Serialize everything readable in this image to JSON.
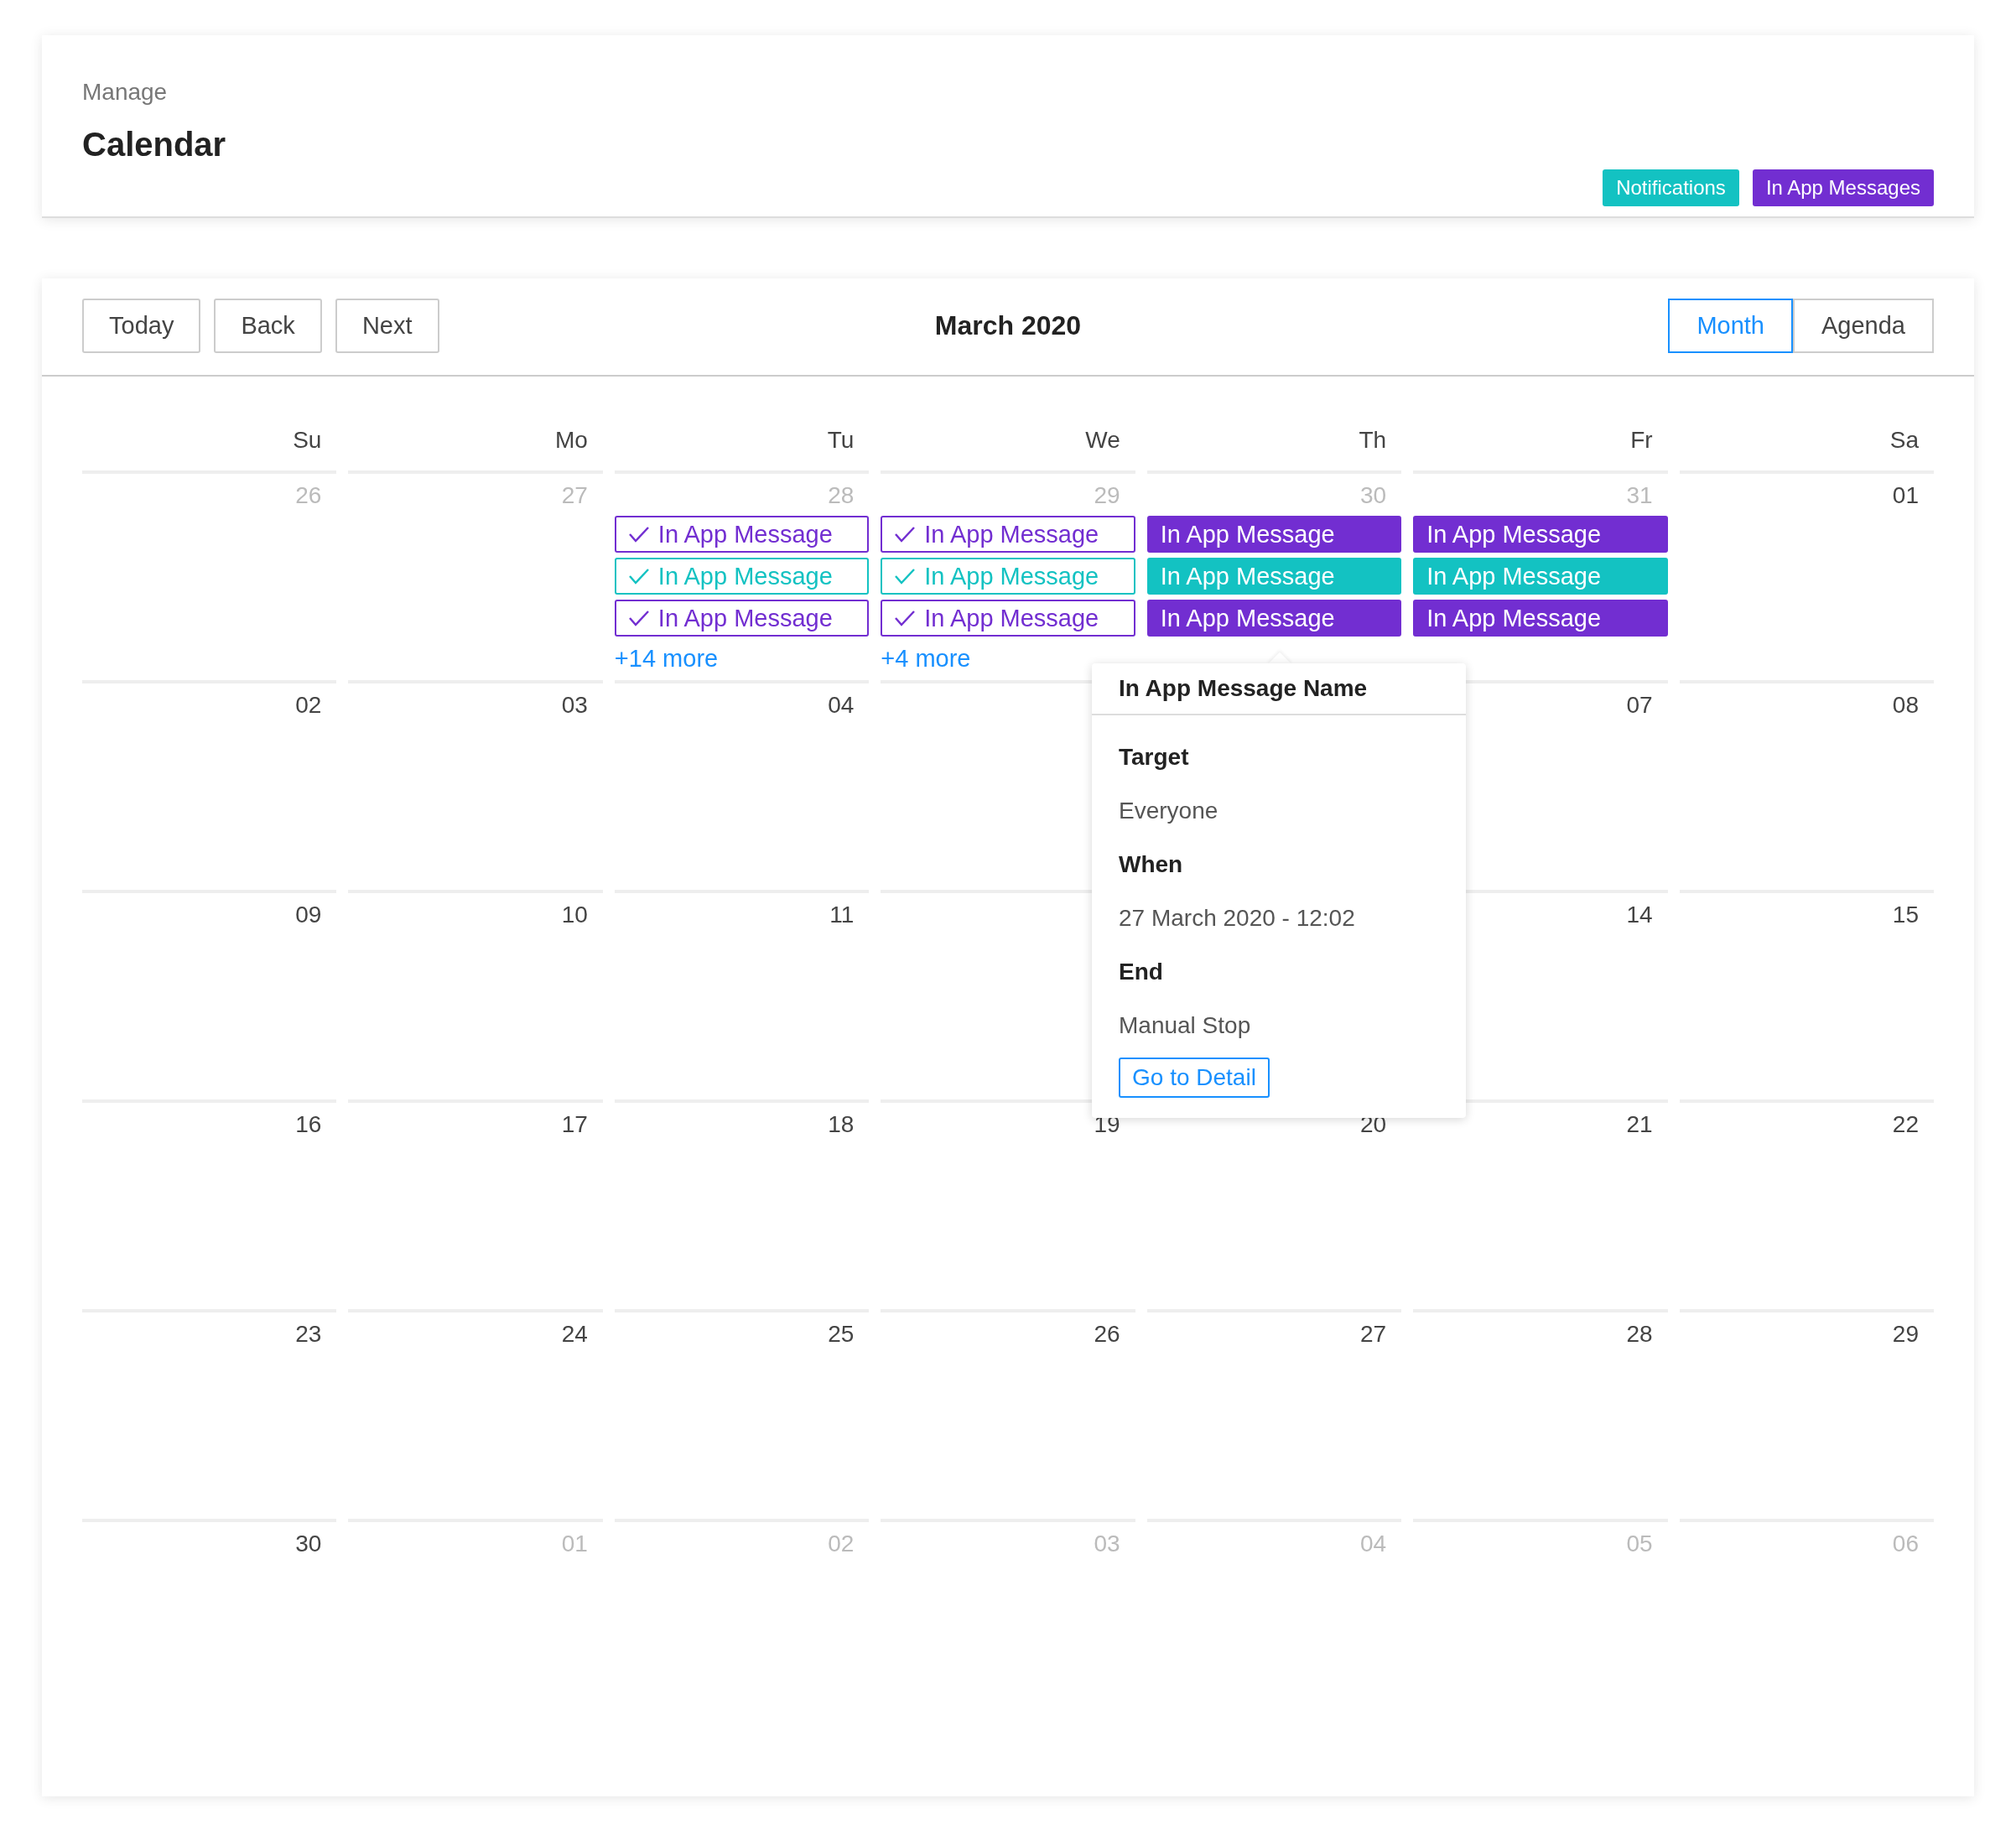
{
  "header": {
    "breadcrumb": "Manage",
    "title": "Calendar",
    "legend": [
      {
        "label": "Notifications",
        "color": "#13c2c2"
      },
      {
        "label": "In App Messages",
        "color": "#722ed1"
      }
    ]
  },
  "toolbar": {
    "nav_buttons": [
      "Today",
      "Back",
      "Next"
    ],
    "title": "March 2020",
    "views": [
      {
        "label": "Month",
        "selected": true
      },
      {
        "label": "Agenda",
        "selected": false
      }
    ]
  },
  "weekdays": [
    "Su",
    "Mo",
    "Tu",
    "We",
    "Th",
    "Fr",
    "Sa"
  ],
  "weeks": [
    {
      "days": [
        {
          "label": "26",
          "muted": true
        },
        {
          "label": "27",
          "muted": true
        },
        {
          "label": "28",
          "muted": true,
          "events": [
            {
              "title": "In App Message",
              "checked": true,
              "color": "#722ed1"
            },
            {
              "title": "In App Message",
              "checked": true,
              "color": "#13c2c2"
            },
            {
              "title": "In App Message",
              "checked": true,
              "color": "#722ed1"
            }
          ],
          "more": "+14 more"
        },
        {
          "label": "29",
          "muted": true,
          "events": [
            {
              "title": "In App Message",
              "checked": true,
              "color": "#722ed1"
            },
            {
              "title": "In App Message",
              "checked": true,
              "color": "#13c2c2"
            },
            {
              "title": "In App Message",
              "checked": true,
              "color": "#722ed1"
            }
          ],
          "more": "+4 more"
        },
        {
          "label": "30",
          "muted": true,
          "events": [
            {
              "title": "In App Message",
              "checked": false,
              "color": "#722ed1"
            },
            {
              "title": "In App Message",
              "checked": false,
              "color": "#13c2c2"
            },
            {
              "title": "In App Message",
              "checked": false,
              "color": "#722ed1"
            }
          ]
        },
        {
          "label": "31",
          "muted": true,
          "events": [
            {
              "title": "In App Message",
              "checked": false,
              "color": "#722ed1"
            },
            {
              "title": "In App Message",
              "checked": false,
              "color": "#13c2c2"
            },
            {
              "title": "In App Message",
              "checked": false,
              "color": "#722ed1"
            }
          ]
        },
        {
          "label": "01",
          "muted": false
        }
      ]
    },
    {
      "days": [
        {
          "label": "02",
          "muted": false
        },
        {
          "label": "03",
          "muted": false
        },
        {
          "label": "04",
          "muted": false
        }
      ],
      "days_after_popover": [
        {
          "label": "07",
          "muted": false
        },
        {
          "label": "08",
          "muted": false
        }
      ]
    },
    {
      "days": [
        {
          "label": "09",
          "muted": false
        },
        {
          "label": "10",
          "muted": false
        },
        {
          "label": "11",
          "muted": false
        }
      ],
      "days_after_popover": [
        {
          "label": "14",
          "muted": false
        },
        {
          "label": "15",
          "muted": false
        }
      ]
    },
    {
      "days": [
        {
          "label": "16",
          "muted": false
        },
        {
          "label": "17",
          "muted": false
        },
        {
          "label": "18",
          "muted": false
        },
        {
          "label": "19",
          "muted": false
        },
        {
          "label": "20",
          "muted": false
        },
        {
          "label": "21",
          "muted": false
        },
        {
          "label": "22",
          "muted": false
        }
      ]
    },
    {
      "days": [
        {
          "label": "23",
          "muted": false
        },
        {
          "label": "24",
          "muted": false
        },
        {
          "label": "25",
          "muted": false
        },
        {
          "label": "26",
          "muted": false
        },
        {
          "label": "27",
          "muted": false
        },
        {
          "label": "28",
          "muted": false
        },
        {
          "label": "29",
          "muted": false
        }
      ]
    },
    {
      "days": [
        {
          "label": "30",
          "muted": false
        },
        {
          "label": "01",
          "muted": true
        },
        {
          "label": "02",
          "muted": true
        },
        {
          "label": "03",
          "muted": true
        },
        {
          "label": "04",
          "muted": true
        },
        {
          "label": "05",
          "muted": true
        },
        {
          "label": "06",
          "muted": true
        }
      ]
    }
  ],
  "popover": {
    "title": "In App Message Name",
    "fields": [
      {
        "label": "Target",
        "value": "Everyone"
      },
      {
        "label": "When",
        "value": "27 March 2020 - 12:02"
      },
      {
        "label": "End",
        "value": "Manual Stop"
      }
    ],
    "button": "Go to Detail"
  }
}
